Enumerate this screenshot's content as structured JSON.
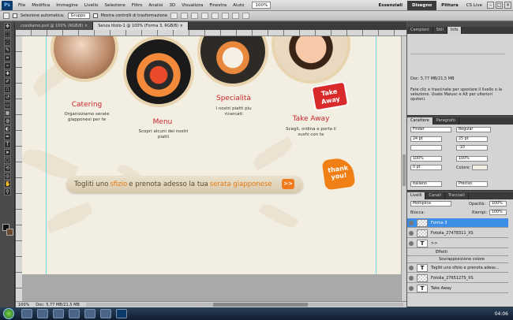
{
  "app": {
    "logo": "Ps"
  },
  "menubar": {
    "items": [
      "File",
      "Modifica",
      "Immagine",
      "Livello",
      "Selezione",
      "Filtro",
      "Analisi",
      "3D",
      "Visualizza",
      "Finestra",
      "Aiuto"
    ],
    "zoom": "100%",
    "workspaces": [
      "Essenziali",
      "Disegno",
      "Pittura"
    ],
    "cslive": "CS Live"
  },
  "options": {
    "auto_select": "Selezione automatica:",
    "auto_select_value": "Gruppo",
    "show_transform": "Mostra controlli di trasformazione"
  },
  "tabs": [
    {
      "label": "cosidiamo.psd @ 100% (RGB/8) ×",
      "active": false
    },
    {
      "label": "Senza titolo-1 @ 100% (Forma 3, RGB/8) ×",
      "active": true
    }
  ],
  "canvas": {
    "sections": [
      {
        "title": "Catering",
        "desc": "Organizziamo serate giapponesi per te",
        "color": "#c9262c"
      },
      {
        "title": "Menu",
        "desc": "Scopri alcuni dei nostri piatti",
        "color": "#c9262c"
      },
      {
        "title": "Specialità",
        "desc": "I nostri piatti piu ricercati",
        "color": "#c9262c"
      },
      {
        "title": "Take Away",
        "desc": "Scegli, ordina e porta il sushi con te",
        "color": "#c9262c"
      }
    ],
    "banner": {
      "pre": "Togliti uno",
      "hl1": "sfizio",
      "mid": "e prenota adesso la tua",
      "hl2": "serata giapponese",
      "arrow": ">>"
    },
    "thankyou": "thank you!",
    "takeaway": "Take Away"
  },
  "status": {
    "zoom": "100%",
    "doc": "Doc: 5,77 MB/21,5 MB"
  },
  "panels": {
    "info_tabs": [
      "Campioni",
      "Stili",
      "Info"
    ],
    "info_doc": "Doc: 5,77 MB/21,5 MB",
    "info_hint": "Fate clic e trascinate per spostare il livello o la selezione. Usate Maiusc e Alt per ulteriori opzioni.",
    "char_tabs": [
      "Carattere",
      "Paragrafo"
    ],
    "char": {
      "font": "Finder",
      "style": "Regular",
      "size": "24 pt",
      "leading": "25 pt",
      "tracking": "-10",
      "kerning": "0 pt",
      "hscale": "100%",
      "vscale": "100%",
      "color_label": "Colore:",
      "lang": "Italiano",
      "aa": "Preciso"
    },
    "layer_tabs": [
      "Livelli",
      "Canali",
      "Tracciati"
    ],
    "blend": "Moltiplica",
    "opacity_label": "Opacità:",
    "opacity": "100%",
    "lock_label": "Blocca:",
    "fill_label": "Riempi:",
    "fill": "100%",
    "layers": [
      {
        "name": "Forma 3",
        "kind": "shape",
        "selected": true
      },
      {
        "name": "Fotolia_27478311_XS",
        "kind": "image",
        "selected": false
      },
      {
        "name": ">>",
        "kind": "text",
        "selected": false
      },
      {
        "name": "Effetti",
        "kind": "effect",
        "selected": false
      },
      {
        "name": "Sovrapposizione colore",
        "kind": "effect",
        "selected": false
      },
      {
        "name": "Togliti uno sfizio e prenota adess...",
        "kind": "text",
        "selected": false
      },
      {
        "name": "Fotolia_2765127S_XS",
        "kind": "image",
        "selected": false
      },
      {
        "name": "Take Away",
        "kind": "text",
        "selected": false
      }
    ]
  },
  "taskbar": {
    "clock": "04:06"
  }
}
